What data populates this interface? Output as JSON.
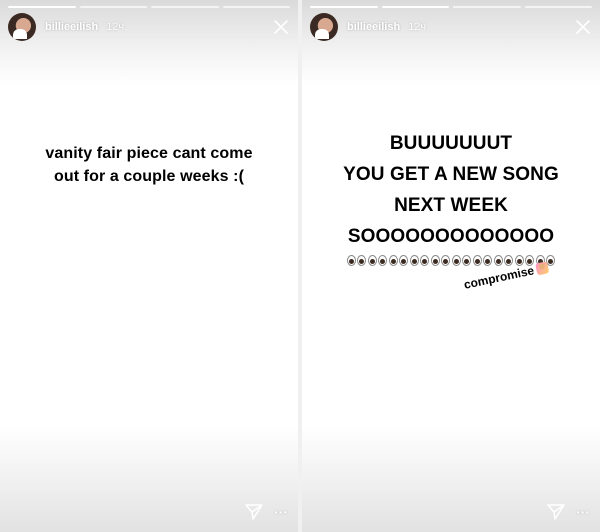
{
  "stories": [
    {
      "username": "billieeilish",
      "time": "12ч.",
      "caption_lines": [
        "vanity fair piece cant come",
        "out for a couple weeks :("
      ],
      "more": "···"
    },
    {
      "username": "billieeilish",
      "time": "12ч.",
      "caption_lines": [
        "BUUUUUUUT",
        "YOU GET A NEW SONG",
        "NEXT WEEK",
        "SOOOOOOOOOOOOO"
      ],
      "eyes_count": 10,
      "sticker_text": "compromise",
      "more": "···"
    }
  ],
  "icons": {
    "close": "close-icon",
    "send": "send-icon",
    "more": "more-options-icon",
    "eyes": "eyes-emoji",
    "person": "person-tipping-hand-emoji"
  }
}
